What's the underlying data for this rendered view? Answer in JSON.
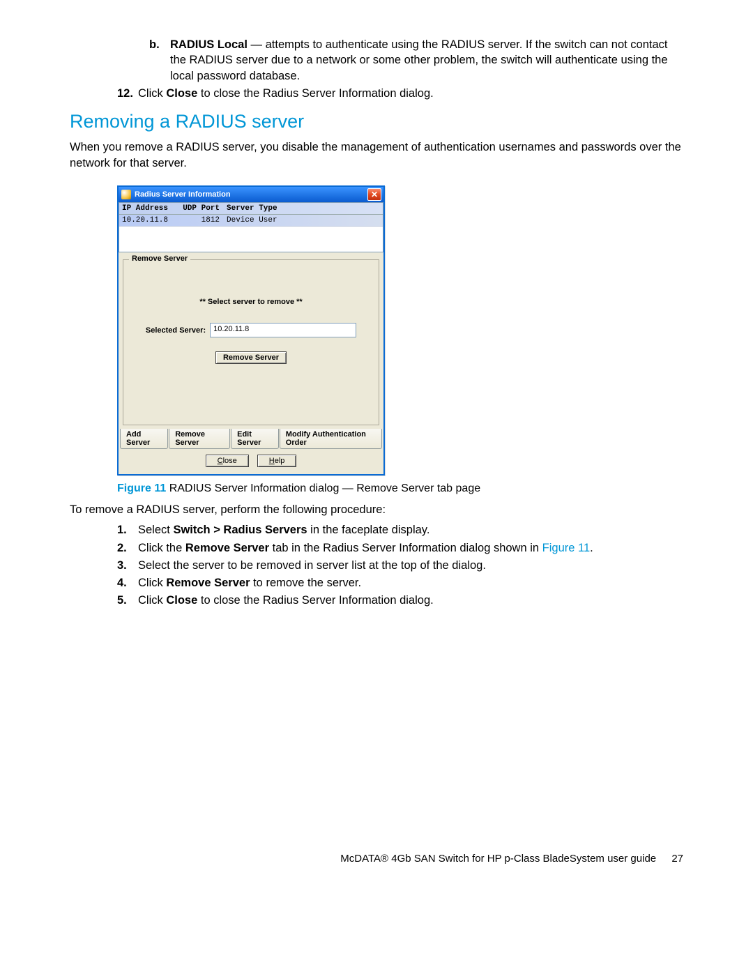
{
  "intro_list": {
    "item_b": {
      "marker": "b.",
      "bold": "RADIUS Local",
      "rest": " — attempts to authenticate using the RADIUS server. If the switch can not contact the RADIUS server due to a network or some other problem, the switch will authenticate using the local password database."
    },
    "item_12": {
      "marker": "12.",
      "pre": "Click ",
      "bold": "Close",
      "post": " to close the Radius Server Information dialog."
    }
  },
  "heading": "Removing a RADIUS server",
  "para1": "When you remove a RADIUS server, you disable the management of authentication usernames and passwords over the network for that server.",
  "dialog": {
    "title": "Radius Server Information",
    "cols": {
      "c1": "IP Address",
      "c2": "UDP Port",
      "c3": "Server Type"
    },
    "row": {
      "c1": "10.20.11.8",
      "c2": "1812",
      "c3": "Device  User"
    },
    "fieldset_label": "Remove Server",
    "msg": "** Select server to remove **",
    "selected_label": "Selected Server:",
    "selected_value": "10.20.11.8",
    "remove_btn": "Remove Server",
    "tabs": {
      "t1": "Add Server",
      "t2": "Remove Server",
      "t3": "Edit Server",
      "t4": "Modify Authentication Order"
    },
    "close_btn": "Close",
    "help_btn": "Help",
    "close_u": "C",
    "close_rest": "lose",
    "help_u": "H",
    "help_rest": "elp"
  },
  "figure": {
    "label": "Figure 11",
    "caption": "  RADIUS Server Information dialog — Remove Server tab page"
  },
  "para2": "To remove a RADIUS server, perform the following procedure:",
  "steps": {
    "s1": {
      "n": "1.",
      "pre": "Select ",
      "b": "Switch > Radius Servers",
      "post": " in the faceplate display."
    },
    "s2": {
      "n": "2.",
      "pre": "Click the ",
      "b": "Remove Server",
      "post1": " tab in the Radius Server Information dialog shown in ",
      "link": "Figure 11",
      "post2": "."
    },
    "s3": {
      "n": "3.",
      "text": "Select the server to be removed in server list at the top of the dialog."
    },
    "s4": {
      "n": "4.",
      "pre": "Click ",
      "b": "Remove Server",
      "post": " to remove the server."
    },
    "s5": {
      "n": "5.",
      "pre": "Click ",
      "b": "Close",
      "post": " to close the Radius Server Information dialog."
    }
  },
  "footer": {
    "text": "McDATA® 4Gb SAN Switch for HP p-Class BladeSystem user guide",
    "page": "27"
  }
}
